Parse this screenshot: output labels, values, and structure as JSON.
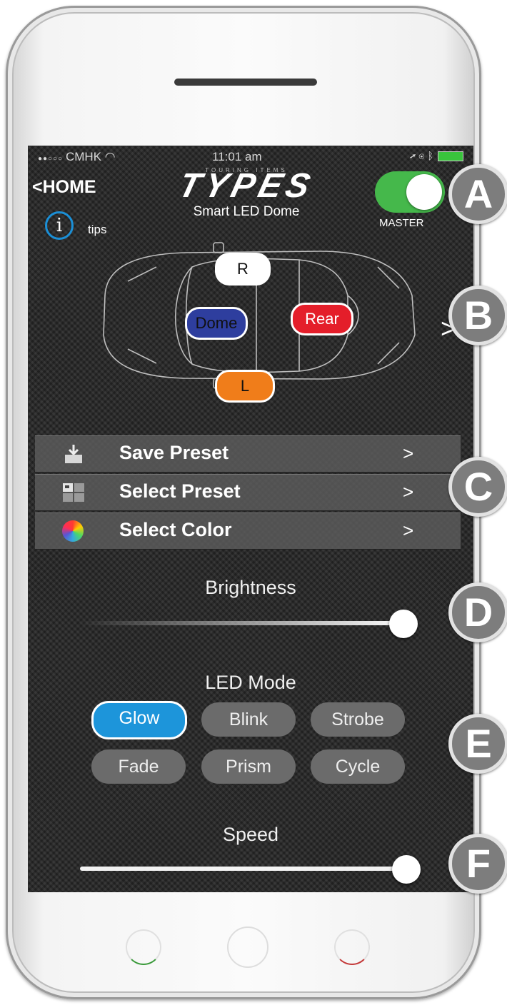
{
  "status_bar": {
    "carrier": "CMHK",
    "time": "11:01 am"
  },
  "header": {
    "back_label": "<HOME",
    "logo_small": "TOURING ITEMS",
    "logo_brand": "TYPES",
    "logo_subtitle": "Smart LED Dome",
    "tips_label": "tips",
    "info_glyph": "i",
    "master_label": "MASTER",
    "master_on": true
  },
  "zones": {
    "right": {
      "label": "R",
      "color": "#ffffff"
    },
    "dome": {
      "label": "Dome",
      "color": "#2e3e9e"
    },
    "rear": {
      "label": "Rear",
      "color": "#e41e2a"
    },
    "left": {
      "label": "L",
      "color": "#f07d1a"
    },
    "next": ">"
  },
  "menu": [
    {
      "label": "Save Preset",
      "arrow": ">",
      "icon": "download-icon"
    },
    {
      "label": "Select Preset",
      "arrow": ">",
      "icon": "preset-grid-icon"
    },
    {
      "label": "Select Color",
      "arrow": ">",
      "icon": "color-wheel-icon"
    }
  ],
  "brightness": {
    "label": "Brightness",
    "value_fraction": 1.0
  },
  "led_mode": {
    "label": "LED Mode",
    "modes": [
      "Glow",
      "Blink",
      "Strobe",
      "Fade",
      "Prism",
      "Cycle"
    ],
    "selected": "Glow"
  },
  "speed": {
    "label": "Speed",
    "value_fraction": 1.0
  },
  "callouts": [
    "A",
    "B",
    "C",
    "D",
    "E",
    "F"
  ],
  "accent_color": "#1d95da",
  "toggle_color": "#45b84b"
}
